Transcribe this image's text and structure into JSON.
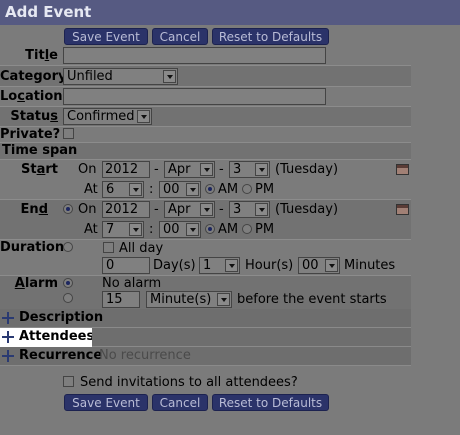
{
  "title": "Add Event",
  "buttons": {
    "save": "Save Event",
    "cancel": "Cancel",
    "reset": "Reset to Defaults"
  },
  "labels": {
    "title_pre": "Tit",
    "title_key": "l",
    "title_post": "e",
    "category_pre": "Category",
    "location_pre": "Lo",
    "location_key": "c",
    "location_post": "ation",
    "status_pre": "Statu",
    "status_key": "s",
    "private": "Private?",
    "timespan": "Time span",
    "start_pre": "St",
    "start_key": "a",
    "start_post": "rt",
    "end_pre": "En",
    "end_key": "d",
    "duration": "Duration",
    "alarm_pre": "",
    "alarm_key": "A",
    "alarm_post": "larm"
  },
  "fields": {
    "title_value": "",
    "location_value": ""
  },
  "category": {
    "selected": "Unfiled"
  },
  "status": {
    "selected": "Confirmed"
  },
  "start": {
    "on": "On",
    "year": "2012",
    "month": "Apr",
    "day": "3",
    "weekday": "(Tuesday)",
    "at": "At",
    "hour": "6",
    "minute": "00",
    "am": "AM",
    "pm": "PM",
    "sep1": "-",
    "sep2": "-",
    "colon": ":"
  },
  "end": {
    "on": "On",
    "year": "2012",
    "month": "Apr",
    "day": "3",
    "weekday": "(Tuesday)",
    "at": "At",
    "hour": "7",
    "minute": "00",
    "am": "AM",
    "pm": "PM",
    "sep1": "-",
    "sep2": "-",
    "colon": ":"
  },
  "duration": {
    "allday": "All day",
    "days_value": "0",
    "days_label": "Day(s)",
    "hours_value": "1",
    "hours_label": "Hour(s)",
    "minutes_value": "00",
    "minutes_label": "Minutes"
  },
  "alarm": {
    "no_alarm": "No alarm",
    "amount": "15",
    "unit": "Minute(s)",
    "suffix": "before the event starts"
  },
  "sections": {
    "description": "Description",
    "attendees": "Attendees",
    "recurrence": "Recurrence",
    "recurrence_value": "No recurrence"
  },
  "invite": "Send invitations to all attendees?"
}
